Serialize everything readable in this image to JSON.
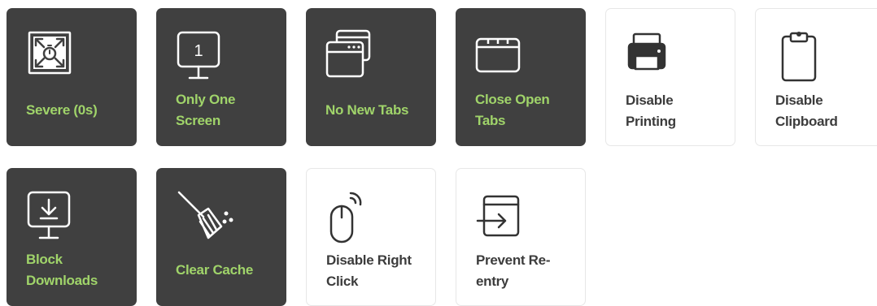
{
  "tiles": [
    {
      "id": "severe",
      "label": "Severe (0s)",
      "icon": "expand-timer-icon",
      "enabled": true
    },
    {
      "id": "one-screen",
      "label": "Only One\nScreen",
      "icon": "single-monitor-icon",
      "enabled": true
    },
    {
      "id": "no-new-tabs",
      "label": "No New Tabs",
      "icon": "stacked-windows-icon",
      "enabled": true
    },
    {
      "id": "close-tabs",
      "label": "Close Open\nTabs",
      "icon": "browser-window-icon",
      "enabled": true
    },
    {
      "id": "printing",
      "label": "Disable\nPrinting",
      "icon": "printer-icon",
      "enabled": false
    },
    {
      "id": "clipboard",
      "label": "Disable\nClipboard",
      "icon": "clipboard-icon",
      "enabled": false
    },
    {
      "id": "downloads",
      "label": "Block\nDownloads",
      "icon": "download-monitor-icon",
      "enabled": true
    },
    {
      "id": "cache",
      "label": "Clear Cache",
      "icon": "broom-icon",
      "enabled": true
    },
    {
      "id": "right-click",
      "label": "Disable Right\nClick",
      "icon": "mouse-click-icon",
      "enabled": false
    },
    {
      "id": "reentry",
      "label": "Prevent Re-\nentry",
      "icon": "enter-window-icon",
      "enabled": false
    }
  ],
  "colors": {
    "enabled_bg": "#404040",
    "enabled_text": "#a0d46a",
    "disabled_bg": "#ffffff",
    "disabled_text": "#3c3c3c"
  }
}
